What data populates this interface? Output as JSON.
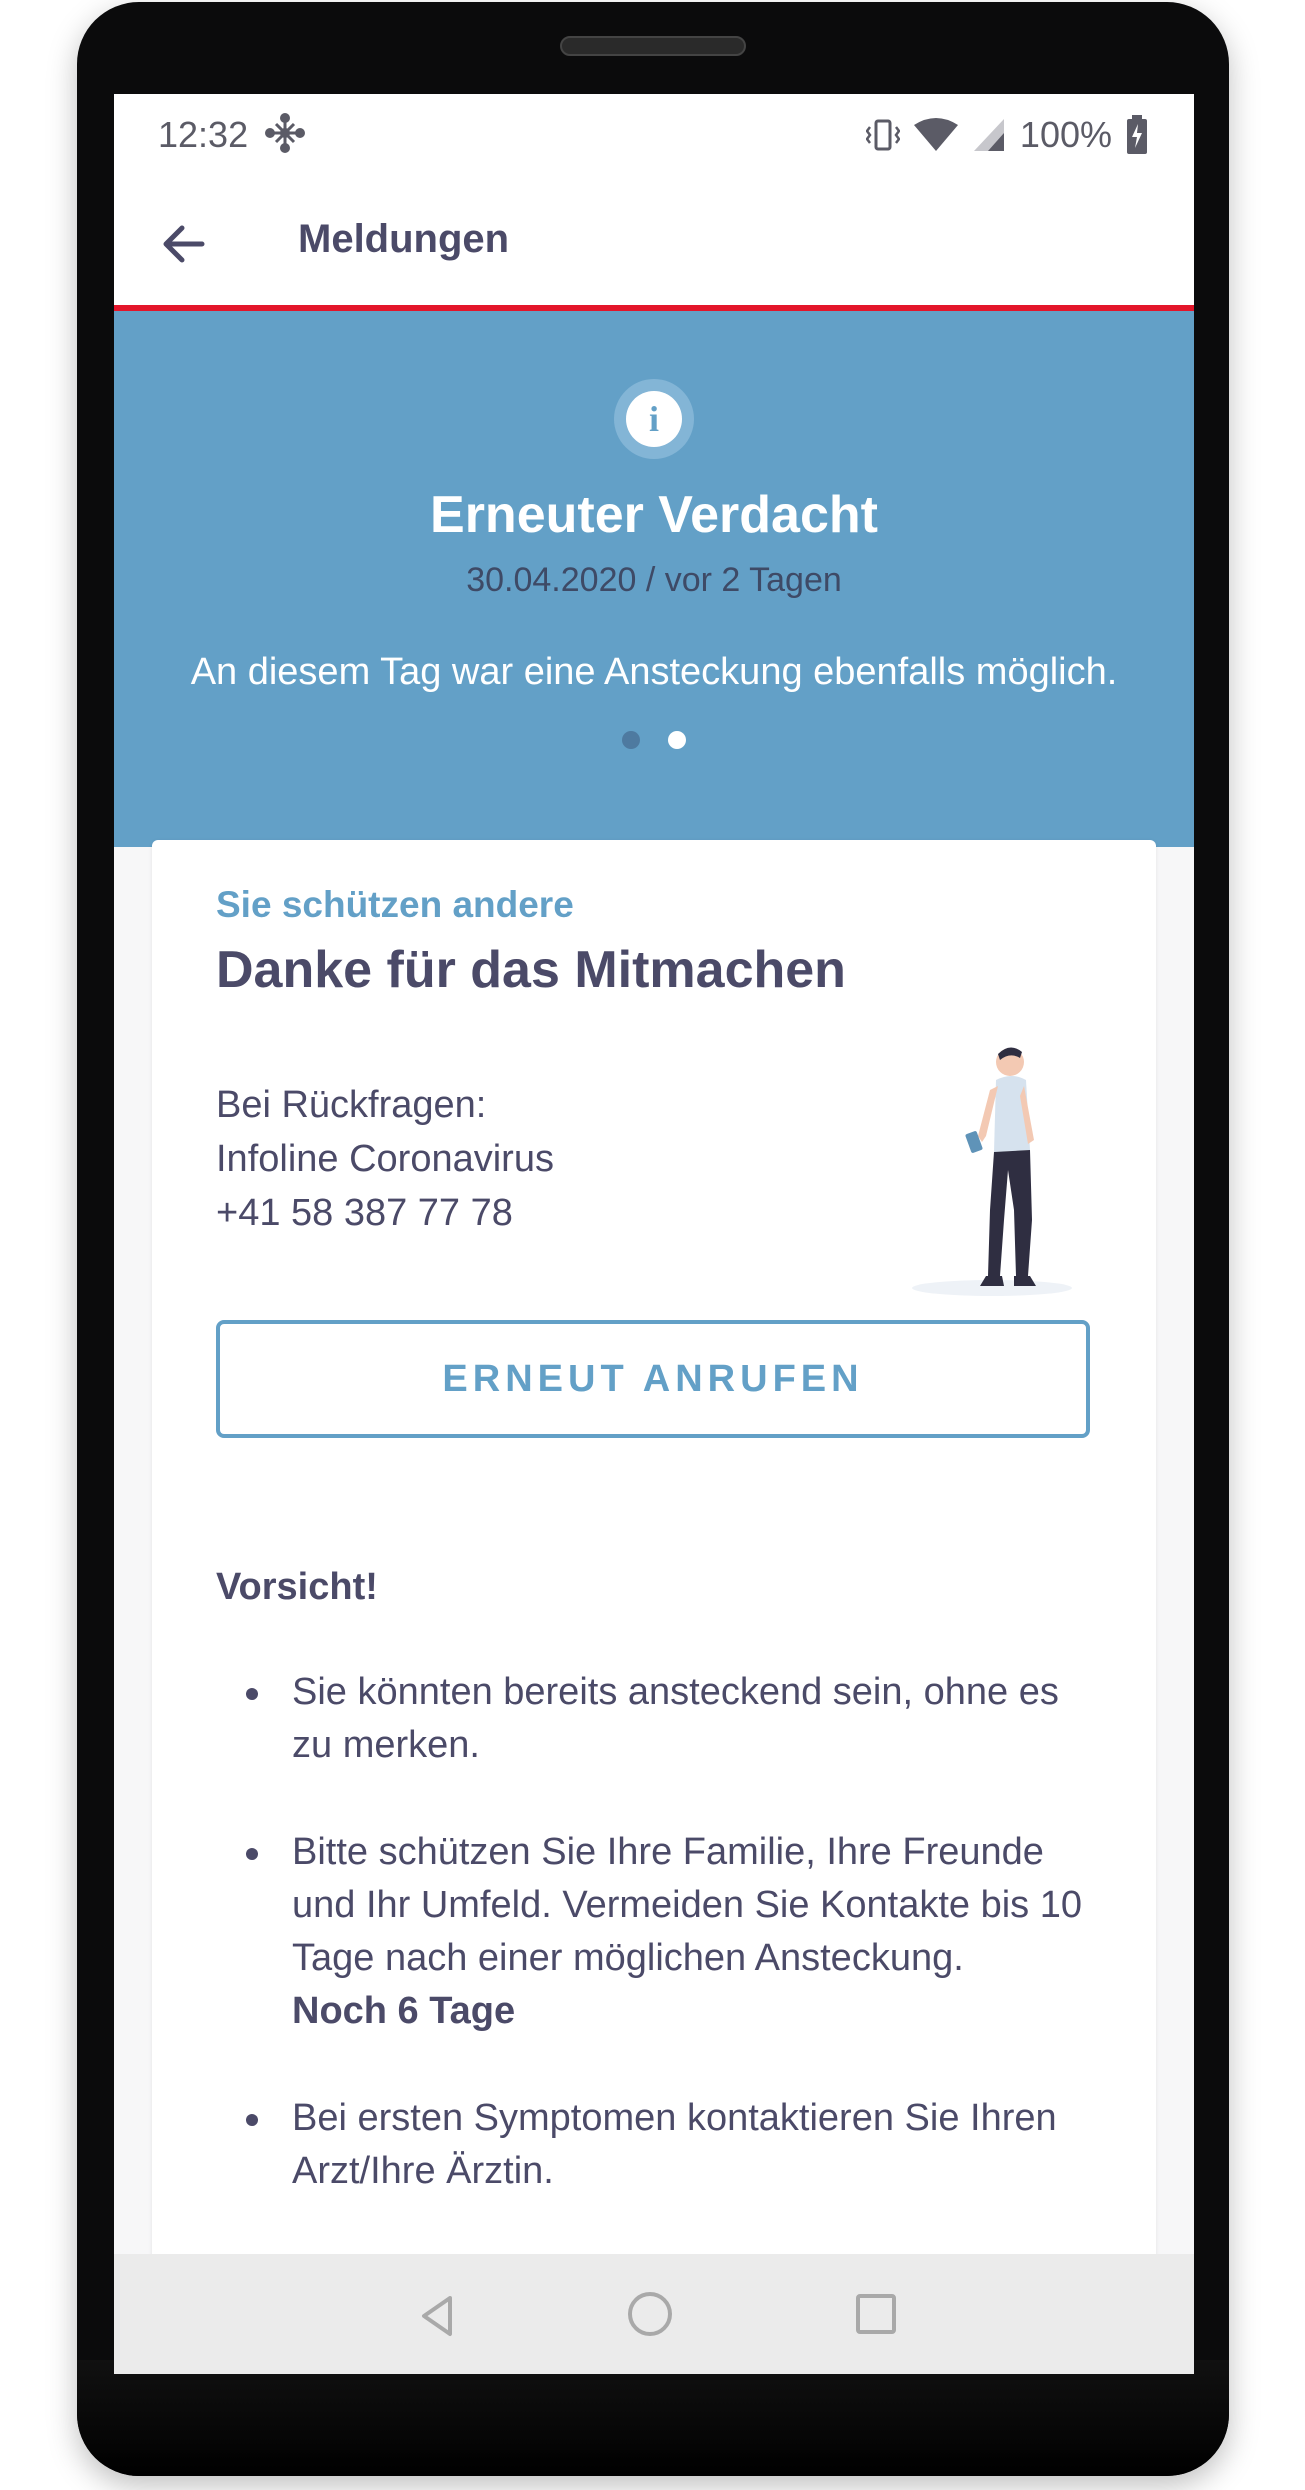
{
  "status_bar": {
    "time": "12:32",
    "battery": "100%"
  },
  "app_bar": {
    "title": "Meldungen"
  },
  "banner": {
    "title": "Erneuter Verdacht",
    "date": "30.04.2020 / vor 2 Tagen",
    "message": "An diesem Tag war eine Ansteckung ebenfalls möglich.",
    "pager": {
      "count": 2,
      "active_index": 1
    }
  },
  "card": {
    "eyebrow": "Sie schützen andere",
    "title": "Danke für das Mitmachen",
    "contact": {
      "line1": "Bei Rückfragen:",
      "line2": "Infoline Coronavirus",
      "line3": "+41 58 387 77 78"
    },
    "call_button": "ERNEUT ANRUFEN",
    "caution_title": "Vorsicht!",
    "bullets": [
      {
        "text": "Sie könnten bereits ansteckend sein, ohne es zu merken.",
        "strong": ""
      },
      {
        "text": "Bitte schützen Sie Ihre Familie, Ihre Freunde und Ihr Umfeld. Vermeiden Sie Kontakte bis 10 Tage nach einer möglichen Ansteckung.",
        "strong": "Noch 6 Tage"
      },
      {
        "text": "Bei ersten Symptomen kontaktieren Sie Ihren Arzt/Ihre Ärztin.",
        "strong": ""
      }
    ]
  },
  "colors": {
    "accent": "#63a0c7",
    "text": "#4b4a68",
    "alert_line": "#e3152a"
  },
  "icons": {
    "back": "arrow-left-icon",
    "info": "info-icon",
    "status_app": "network-icon"
  }
}
